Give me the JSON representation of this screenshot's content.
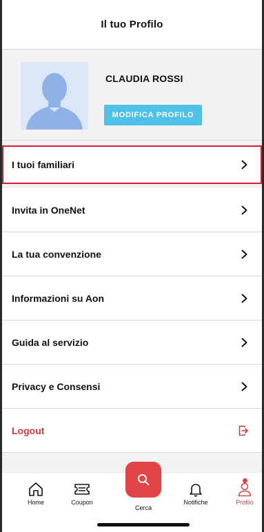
{
  "header": {
    "title": "Il tuo Profilo"
  },
  "profile": {
    "name": "CLAUDIA ROSSI",
    "edit_label": "MODIFICA PROFILO"
  },
  "menu": {
    "items": [
      {
        "label": "I tuoi familiari",
        "highlighted": true
      },
      {
        "label": "Invita in OneNet"
      },
      {
        "label": "La tua convenzione"
      },
      {
        "label": "Informazioni su Aon"
      },
      {
        "label": "Guida al servizio"
      },
      {
        "label": "Privacy e Consensi"
      }
    ],
    "logout_label": "Logout"
  },
  "tabbar": {
    "home": "Home",
    "coupon": "Coupon",
    "search": "Cerca",
    "notifications": "Notifiche",
    "profile": "Profilo",
    "active": "profile"
  },
  "colors": {
    "accent_red": "#e04444",
    "edit_button": "#4fc0e6",
    "highlight_border": "#d81e2c"
  },
  "icons": {
    "menu_arrow": "chevron-right-icon",
    "logout": "logout-icon",
    "home": "home-icon",
    "coupon": "ticket-icon",
    "search": "search-icon",
    "notifications": "bell-icon",
    "profile": "user-icon"
  }
}
